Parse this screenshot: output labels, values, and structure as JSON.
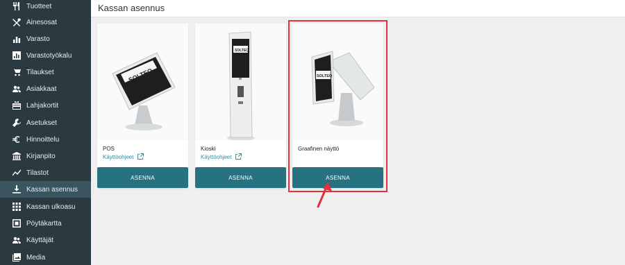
{
  "sidebar": {
    "items": [
      {
        "label": "Tuotteet",
        "icon": "cutlery-icon"
      },
      {
        "label": "Ainesosat",
        "icon": "utensils-cross-icon"
      },
      {
        "label": "Varasto",
        "icon": "bar-chart-icon"
      },
      {
        "label": "Varastotyökalu",
        "icon": "chart-box-icon"
      },
      {
        "label": "Tilaukset",
        "icon": "cart-icon"
      },
      {
        "label": "Asiakkaat",
        "icon": "users-icon"
      },
      {
        "label": "Lahjakortit",
        "icon": "gift-card-icon"
      },
      {
        "label": "Asetukset",
        "icon": "wrench-icon"
      },
      {
        "label": "Hinnoittelu",
        "icon": "euro-icon"
      },
      {
        "label": "Kirjanpito",
        "icon": "bank-icon"
      },
      {
        "label": "Tilastot",
        "icon": "trend-line-icon"
      },
      {
        "label": "Kassan asennus",
        "icon": "download-icon",
        "active": true
      },
      {
        "label": "Kassan ulkoasu",
        "icon": "grid-icon"
      },
      {
        "label": "Pöytäkartta",
        "icon": "table-map-icon"
      },
      {
        "label": "Käyttäjät",
        "icon": "users-icon"
      },
      {
        "label": "Media",
        "icon": "image-icon"
      }
    ]
  },
  "header": {
    "title": "Kassan asennus"
  },
  "cards": [
    {
      "title": "POS",
      "link": "Käyttöohjeet",
      "button": "ASENNA"
    },
    {
      "title": "Kioski",
      "link": "Käyttöohjeet",
      "button": "ASENNA"
    },
    {
      "title": "Graafinen näyttö",
      "link": "",
      "button": "ASENNA"
    }
  ],
  "brand_text": "SOLTEQ",
  "colors": {
    "sidebar_bg": "#2a3a40",
    "sidebar_active": "#3b5560",
    "button_bg": "#267280",
    "link": "#2f8ba0",
    "highlight": "#e3323b"
  }
}
